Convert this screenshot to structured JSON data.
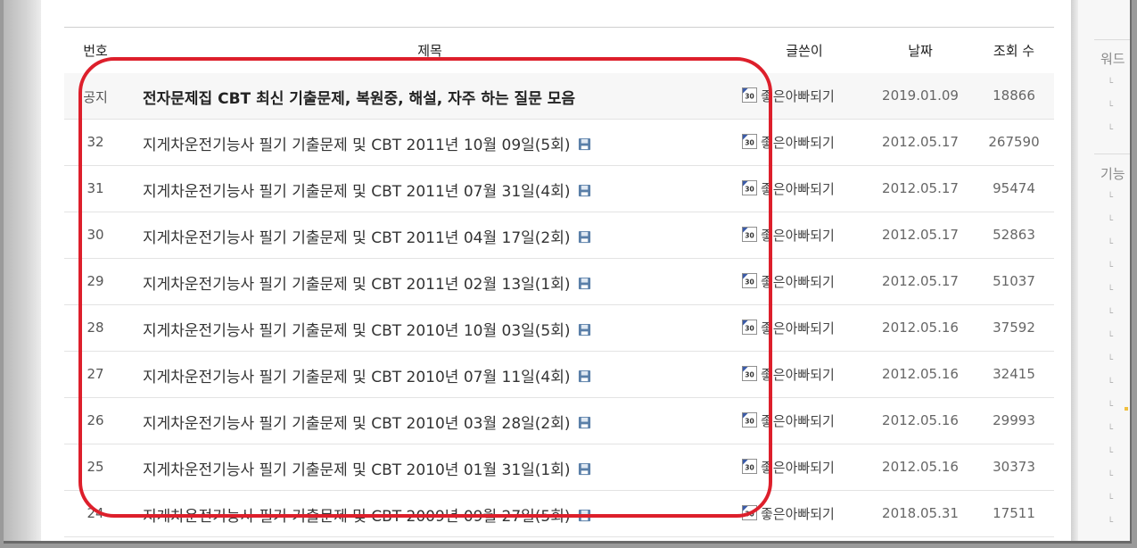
{
  "table": {
    "headers": {
      "num": "번호",
      "title": "제목",
      "writer": "글쓴이",
      "date": "날짜",
      "views": "조회 수"
    },
    "rows": [
      {
        "num": "공지",
        "title": "전자문제집 CBT 최신 기출문제, 복원중, 해설, 자주 하는 질문 모음",
        "writer": "좋은아빠되기",
        "date": "2019.01.09",
        "views": "18866",
        "notice": true
      },
      {
        "num": "32",
        "title": "지게차운전기능사 필기 기출문제 및 CBT 2011년 10월 09일(5회)",
        "writer": "좋은아빠되기",
        "date": "2012.05.17",
        "views": "267590"
      },
      {
        "num": "31",
        "title": "지게차운전기능사 필기 기출문제 및 CBT 2011년 07월 31일(4회)",
        "writer": "좋은아빠되기",
        "date": "2012.05.17",
        "views": "95474"
      },
      {
        "num": "30",
        "title": "지게차운전기능사 필기 기출문제 및 CBT 2011년 04월 17일(2회)",
        "writer": "좋은아빠되기",
        "date": "2012.05.17",
        "views": "52863"
      },
      {
        "num": "29",
        "title": "지게차운전기능사 필기 기출문제 및 CBT 2011년 02월 13일(1회)",
        "writer": "좋은아빠되기",
        "date": "2012.05.17",
        "views": "51037"
      },
      {
        "num": "28",
        "title": "지게차운전기능사 필기 기출문제 및 CBT 2010년 10월 03일(5회)",
        "writer": "좋은아빠되기",
        "date": "2012.05.16",
        "views": "37592"
      },
      {
        "num": "27",
        "title": "지게차운전기능사 필기 기출문제 및 CBT 2010년 07월 11일(4회)",
        "writer": "좋은아빠되기",
        "date": "2012.05.16",
        "views": "32415"
      },
      {
        "num": "26",
        "title": "지게차운전기능사 필기 기출문제 및 CBT 2010년 03월 28일(2회)",
        "writer": "좋은아빠되기",
        "date": "2012.05.16",
        "views": "29993"
      },
      {
        "num": "25",
        "title": "지게차운전기능사 필기 기출문제 및 CBT 2010년 01월 31일(1회)",
        "writer": "좋은아빠되기",
        "date": "2012.05.16",
        "views": "30373"
      },
      {
        "num": "24",
        "title": "지게차운전기능사 필기 기출문제 및 CBT 2009년 09월 27일(5회)",
        "writer": "좋은아빠되기",
        "date": "2018.05.31",
        "views": "17511"
      }
    ]
  },
  "sidebar": {
    "heading_1": "워드",
    "heading_2": "기능"
  },
  "colors": {
    "highlight": "#dd1f2b",
    "notice_bg": "#f7f7f7"
  },
  "icons": {
    "attachment": "save-icon",
    "writer_badge": "member-badge-icon"
  }
}
